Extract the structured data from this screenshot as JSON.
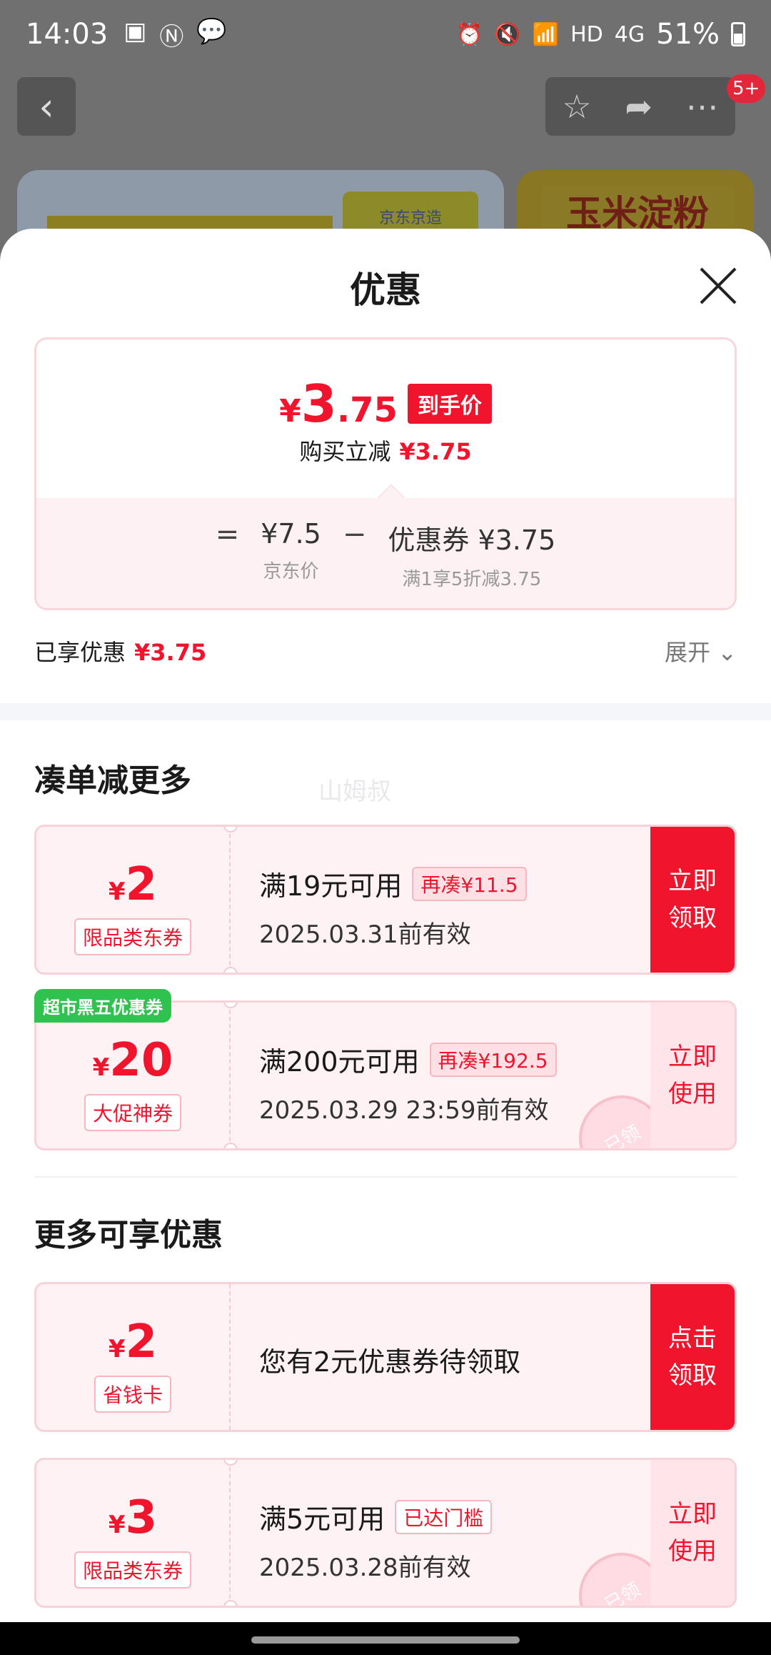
{
  "status_bar": {
    "time": "14:03",
    "network": "HD",
    "signal": "4G",
    "battery": "51%"
  },
  "background": {
    "card1_logo": "京东京造",
    "card2_label": "玉米淀粉",
    "badge": "5+"
  },
  "sheet": {
    "title": "优惠",
    "final_price": {
      "yen": "¥",
      "int": "3",
      "dec": ".75",
      "tag": "到手价"
    },
    "reduce_label": "购买立减",
    "reduce_amount": "¥3.75",
    "calc": {
      "eq": "=",
      "jd_price": "¥7.5",
      "jd_price_label": "京东价",
      "minus": "−",
      "coupon_label": "优惠券 ¥3.75",
      "coupon_rule": "满1享5折减3.75"
    },
    "enjoyed_label": "已享优惠",
    "enjoyed_amount": "¥3.75",
    "expand_label": "展开"
  },
  "section1": {
    "title": "凑单减更多",
    "watermark": "山姆叔",
    "coupons": [
      {
        "yen": "¥",
        "amount": "2",
        "kind": "限品类东券",
        "condition": "满19元可用",
        "pill": "再凑¥11.5",
        "validity": "2025.03.31前有效",
        "action_line1": "立即",
        "action_line2": "领取"
      },
      {
        "ribbon": "超市黑五优惠券",
        "yen": "¥",
        "amount": "20",
        "kind": "大促神券",
        "condition": "满200元可用",
        "pill": "再凑¥192.5",
        "validity": "2025.03.29 23:59前有效",
        "action_line1": "立即",
        "action_line2": "使用",
        "stamp": "已领"
      }
    ]
  },
  "section2": {
    "title": "更多可享优惠",
    "coupons": [
      {
        "yen": "¥",
        "amount": "2",
        "kind": "省钱卡",
        "condition": "您有2元优惠券待领取",
        "action_line1": "点击",
        "action_line2": "领取"
      },
      {
        "yen": "¥",
        "amount": "3",
        "kind": "限品类东券",
        "condition": "满5元可用",
        "pill": "已达门槛",
        "validity": "2025.03.28前有效",
        "action_line1": "立即",
        "action_line2": "使用",
        "stamp": "已领"
      }
    ]
  },
  "colors": {
    "accent": "#f0142d",
    "ribbon": "#2fc24f",
    "coupon_bg": "#fff2f4"
  },
  "icons": [
    "back-icon",
    "star-icon",
    "share-icon",
    "more-icon",
    "close-icon",
    "chevron-down-icon"
  ]
}
